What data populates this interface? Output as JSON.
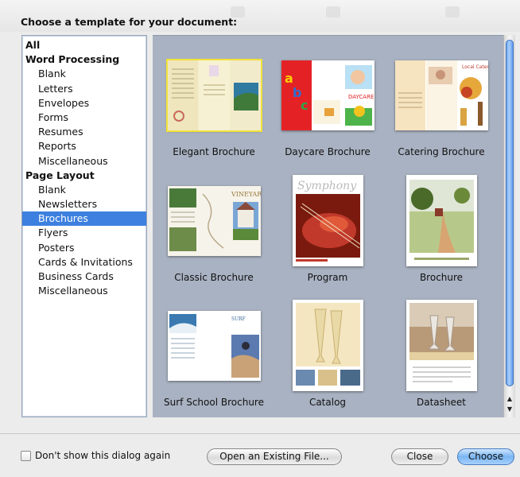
{
  "dialog": {
    "heading": "Choose a template for your document:"
  },
  "sidebar": {
    "items": [
      {
        "label": "All",
        "type": "head"
      },
      {
        "label": "Word Processing",
        "type": "head"
      },
      {
        "label": "Blank",
        "type": "item"
      },
      {
        "label": "Letters",
        "type": "item"
      },
      {
        "label": "Envelopes",
        "type": "item"
      },
      {
        "label": "Forms",
        "type": "item"
      },
      {
        "label": "Resumes",
        "type": "item"
      },
      {
        "label": "Reports",
        "type": "item"
      },
      {
        "label": "Miscellaneous",
        "type": "item"
      },
      {
        "label": "Page Layout",
        "type": "head"
      },
      {
        "label": "Blank",
        "type": "item"
      },
      {
        "label": "Newsletters",
        "type": "item"
      },
      {
        "label": "Brochures",
        "type": "item",
        "selected": true
      },
      {
        "label": "Flyers",
        "type": "item"
      },
      {
        "label": "Posters",
        "type": "item"
      },
      {
        "label": "Cards & Invitations",
        "type": "item"
      },
      {
        "label": "Business Cards",
        "type": "item"
      },
      {
        "label": "Miscellaneous",
        "type": "item"
      }
    ]
  },
  "templates": [
    {
      "name": "Elegant Brochure",
      "selected": true,
      "thumb_text": ""
    },
    {
      "name": "Daycare Brochure",
      "thumb_text": "a b c"
    },
    {
      "name": "Catering Brochure",
      "thumb_text": "Local Catering"
    },
    {
      "name": "Classic Brochure",
      "thumb_text": "VINEYARD"
    },
    {
      "name": "Program",
      "thumb_text": "Symphony"
    },
    {
      "name": "Brochure",
      "thumb_text": ""
    },
    {
      "name": "Surf School Brochure",
      "thumb_text": ""
    },
    {
      "name": "Catalog",
      "thumb_text": ""
    },
    {
      "name": "Datasheet",
      "thumb_text": ""
    }
  ],
  "footer": {
    "checkbox_label": "Don't show this dialog again",
    "open_existing_label": "Open an Existing File...",
    "close_label": "Close",
    "choose_label": "Choose"
  },
  "colors": {
    "selection": "#3d80df",
    "gallery_bg": "#a9b2c2",
    "selected_thumb_outline": "#f2e23a"
  }
}
